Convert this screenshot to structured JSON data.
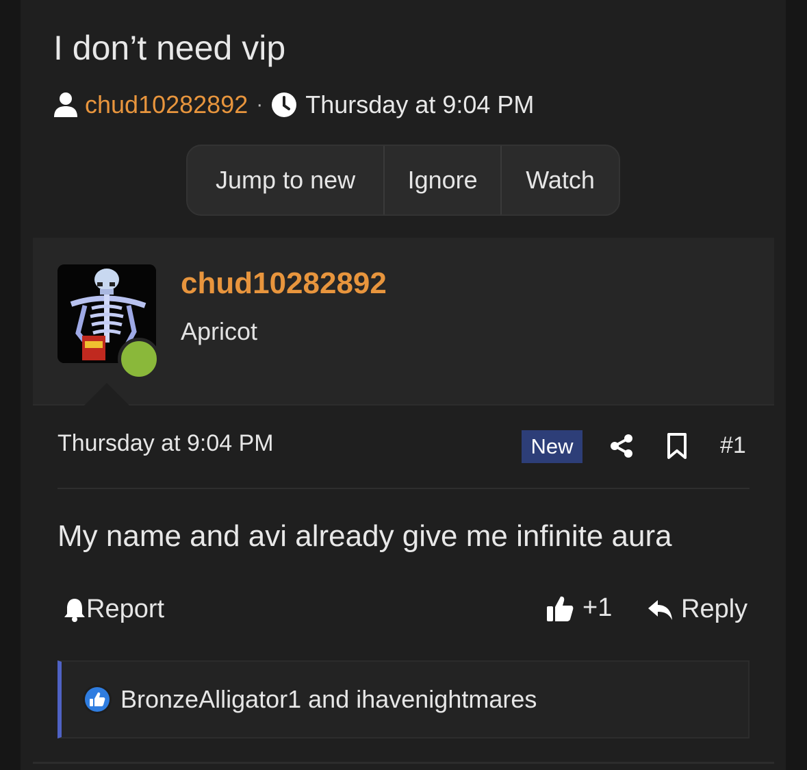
{
  "thread": {
    "title": "I don’t need vip",
    "author": "chud10282892",
    "separator": "·",
    "timestamp": "Thursday at 9:04 PM"
  },
  "actions": {
    "jump_to_new": "Jump to new",
    "ignore": "Ignore",
    "watch": "Watch"
  },
  "post": {
    "username": "chud10282892",
    "user_title": "Apricot",
    "date": "Thursday at 9:04 PM",
    "badge": "New",
    "number": "#1",
    "body": "My name and avi already give me infinite aura",
    "report_label": "Report",
    "like_label": "+1",
    "reply_label": "Reply",
    "reactions_text": "BronzeAlligator1 and ihavenightmares"
  },
  "colors": {
    "accent": "#e8953d",
    "online": "#8ab83a",
    "badge_bg": "#2d3e78",
    "reaction_border": "#4f62c4"
  }
}
